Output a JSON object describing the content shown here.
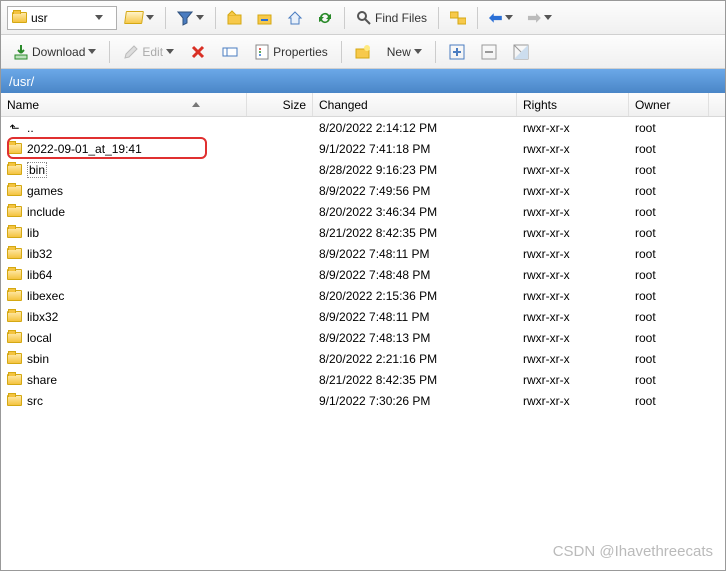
{
  "address": {
    "value": "usr"
  },
  "path": "/usr/",
  "toolbar": {
    "find_files": "Find Files",
    "download": "Download",
    "edit": "Edit",
    "properties": "Properties",
    "new": "New"
  },
  "columns": {
    "name": "Name",
    "size": "Size",
    "changed": "Changed",
    "rights": "Rights",
    "owner": "Owner"
  },
  "rows": [
    {
      "name": "..",
      "changed": "8/20/2022 2:14:12 PM",
      "rights": "rwxr-xr-x",
      "owner": "root",
      "parent": true
    },
    {
      "name": "2022-09-01_at_19:41",
      "changed": "9/1/2022 7:41:18 PM",
      "rights": "rwxr-xr-x",
      "owner": "root",
      "highlighted": true
    },
    {
      "name": "bin",
      "changed": "8/28/2022 9:16:23 PM",
      "rights": "rwxr-xr-x",
      "owner": "root",
      "focused": true
    },
    {
      "name": "games",
      "changed": "8/9/2022 7:49:56 PM",
      "rights": "rwxr-xr-x",
      "owner": "root"
    },
    {
      "name": "include",
      "changed": "8/20/2022 3:46:34 PM",
      "rights": "rwxr-xr-x",
      "owner": "root"
    },
    {
      "name": "lib",
      "changed": "8/21/2022 8:42:35 PM",
      "rights": "rwxr-xr-x",
      "owner": "root"
    },
    {
      "name": "lib32",
      "changed": "8/9/2022 7:48:11 PM",
      "rights": "rwxr-xr-x",
      "owner": "root"
    },
    {
      "name": "lib64",
      "changed": "8/9/2022 7:48:48 PM",
      "rights": "rwxr-xr-x",
      "owner": "root"
    },
    {
      "name": "libexec",
      "changed": "8/20/2022 2:15:36 PM",
      "rights": "rwxr-xr-x",
      "owner": "root"
    },
    {
      "name": "libx32",
      "changed": "8/9/2022 7:48:11 PM",
      "rights": "rwxr-xr-x",
      "owner": "root"
    },
    {
      "name": "local",
      "changed": "8/9/2022 7:48:13 PM",
      "rights": "rwxr-xr-x",
      "owner": "root"
    },
    {
      "name": "sbin",
      "changed": "8/20/2022 2:21:16 PM",
      "rights": "rwxr-xr-x",
      "owner": "root"
    },
    {
      "name": "share",
      "changed": "8/21/2022 8:42:35 PM",
      "rights": "rwxr-xr-x",
      "owner": "root"
    },
    {
      "name": "src",
      "changed": "9/1/2022 7:30:26 PM",
      "rights": "rwxr-xr-x",
      "owner": "root"
    }
  ],
  "watermark": "CSDN @Ihavethreecats"
}
